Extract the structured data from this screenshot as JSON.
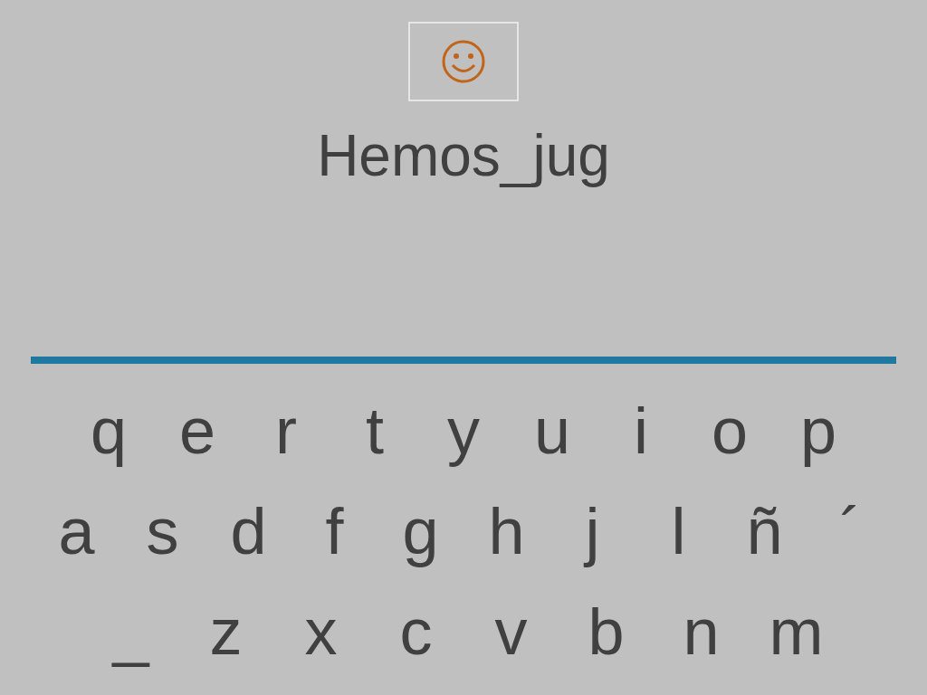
{
  "word": "Hemos_jug",
  "keyboard": {
    "rows": [
      [
        "q",
        "e",
        "r",
        "t",
        "y",
        "u",
        "i",
        "o",
        "p"
      ],
      [
        "a",
        "s",
        "d",
        "f",
        "g",
        "h",
        "j",
        "l",
        "ñ",
        "´"
      ],
      [
        "_",
        "z",
        "x",
        "c",
        "v",
        "b",
        "n",
        "m"
      ]
    ]
  }
}
